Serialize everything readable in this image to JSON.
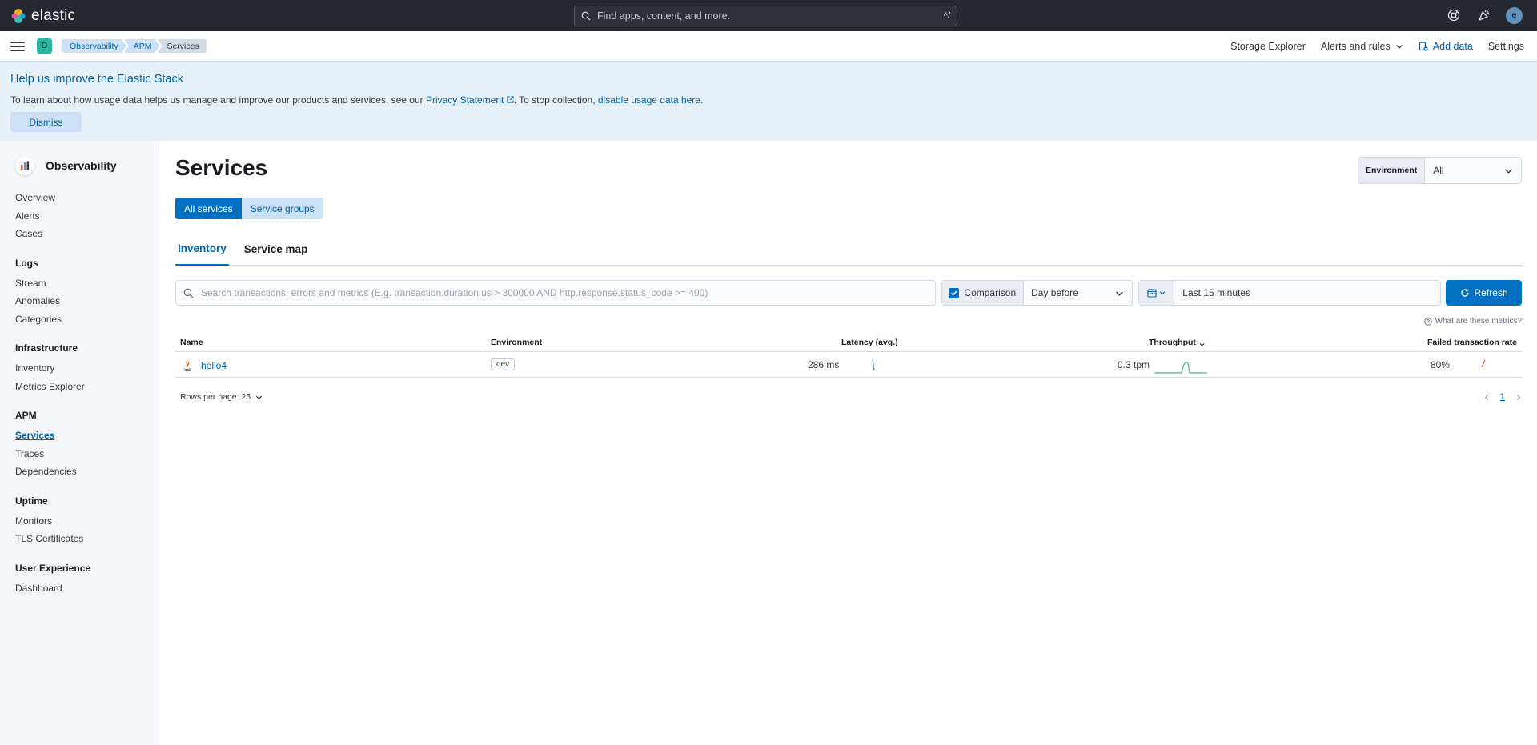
{
  "header": {
    "brand": "elastic",
    "search_placeholder": "Find apps, content, and more.",
    "search_shortcut": "^/",
    "user_initial": "e"
  },
  "subbar": {
    "space_initial": "D",
    "breadcrumbs": [
      "Observability",
      "APM",
      "Services"
    ],
    "storage_explorer": "Storage Explorer",
    "alerts_rules": "Alerts and rules",
    "add_data": "Add data",
    "settings": "Settings"
  },
  "callout": {
    "title": "Help us improve the Elastic Stack",
    "text_before": "To learn about how usage data helps us manage and improve our products and services, see our ",
    "privacy_link": "Privacy Statement",
    "text_middle": ". To stop collection, ",
    "disable_link": "disable usage data here.",
    "dismiss": "Dismiss"
  },
  "sidebar": {
    "title": "Observability",
    "top_items": [
      "Overview",
      "Alerts",
      "Cases"
    ],
    "groups": [
      {
        "title": "Logs",
        "items": [
          "Stream",
          "Anomalies",
          "Categories"
        ]
      },
      {
        "title": "Infrastructure",
        "items": [
          "Inventory",
          "Metrics Explorer"
        ]
      },
      {
        "title": "APM",
        "items": [
          "Services",
          "Traces",
          "Dependencies"
        ]
      },
      {
        "title": "Uptime",
        "items": [
          "Monitors",
          "TLS Certificates"
        ]
      },
      {
        "title": "User Experience",
        "items": [
          "Dashboard"
        ]
      }
    ],
    "active_item": "Services"
  },
  "main": {
    "title": "Services",
    "environment_label": "Environment",
    "environment_value": "All",
    "all_services": "All services",
    "service_groups": "Service groups",
    "tabs": [
      "Inventory",
      "Service map"
    ],
    "active_tab": "Inventory",
    "search_placeholder": "Search transactions, errors and metrics (E.g. transaction.duration.us > 300000 AND http.response.status_code >= 400)",
    "comparison_label": "Comparison",
    "comparison_value": "Day before",
    "date_range": "Last 15 minutes",
    "refresh": "Refresh",
    "metrics_help": "What are these metrics?",
    "columns": {
      "name": "Name",
      "environment": "Environment",
      "latency": "Latency (avg.)",
      "throughput": "Throughput",
      "failed_rate": "Failed transaction rate"
    },
    "rows": [
      {
        "name": "hello4",
        "environment": "dev",
        "latency": "286 ms",
        "throughput": "0.3 tpm",
        "failed_rate": "80%"
      }
    ],
    "rows_per_page": "Rows per page: 25",
    "current_page": "1"
  },
  "colors": {
    "topbar": "#25282f",
    "primary": "#0071c2",
    "callout_bg": "#e6f1fa",
    "latency_spark": "#6092c0",
    "throughput_spark": "#54b399",
    "failed_spark": "#e7664c"
  }
}
